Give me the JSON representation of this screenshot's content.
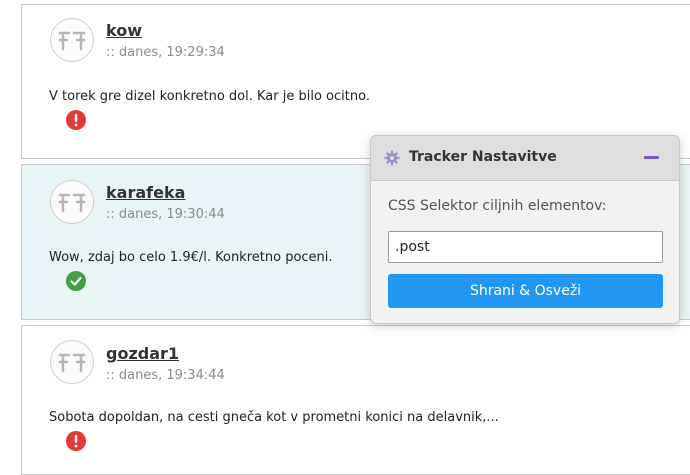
{
  "posts": [
    {
      "username": "kow",
      "timestamp": ":: danes, 19:29:34",
      "text": "V torek gre dizel konkretno dol. Kar je bilo ocitno.",
      "status": "negative",
      "status_icon": "exclamation-icon",
      "status_color": "#e53935"
    },
    {
      "username": "karafeka",
      "timestamp": ":: danes, 19:30:44",
      "text": "Wow, zdaj bo celo 1.9€/l. Konkretno poceni.",
      "status": "positive",
      "status_icon": "checkmark-icon",
      "status_color": "#43a047"
    },
    {
      "username": "gozdar1",
      "timestamp": ":: danes, 19:34:44",
      "text": "Sobota dopoldan, na cesti gneča kot v prometni konici na delavnik,...",
      "status": "negative",
      "status_icon": "exclamation-icon",
      "status_color": "#e53935"
    }
  ],
  "tracker_panel": {
    "title": "Tracker Nastavitve",
    "icon": "gear-icon",
    "field_label": "CSS Selektor ciljnih elementov:",
    "selector_value": ".post",
    "save_button": "Shrani & Osveži",
    "accent_color": "#2196f3"
  }
}
